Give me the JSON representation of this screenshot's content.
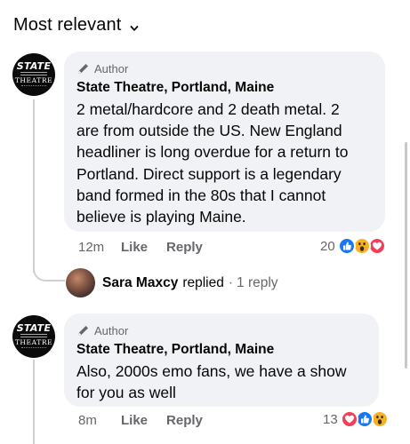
{
  "sort": {
    "label": "Most relevant"
  },
  "comments": [
    {
      "avatar": {
        "top": "STATE",
        "bottom": "THEATRE"
      },
      "badge": "Author",
      "name": "State Theatre, Portland, Maine",
      "lines": [
        "2 metal/hardcore and 2 death metal. 2",
        "are from outside the US. New England",
        "headliner is long overdue for a return to",
        "Portland. Direct support is a legendary",
        "band formed in the 80s that I cannot",
        "believe is playing Maine."
      ],
      "time": "12m",
      "like": "Like",
      "reply": "Reply",
      "reaction_count": "20",
      "reaction_icons": [
        "like-icon",
        "wow-icon",
        "love-icon"
      ]
    },
    {
      "avatar": {
        "top": "STATE",
        "bottom": "THEATRE"
      },
      "badge": "Author",
      "name": "State Theatre, Portland, Maine",
      "lines": [
        "Also, 2000s emo fans, we have a show",
        "for you as well"
      ],
      "time": "8m",
      "like": "Like",
      "reply": "Reply",
      "reaction_count": "13",
      "reaction_icons": [
        "love-icon",
        "like-icon",
        "wow-icon"
      ]
    }
  ],
  "replied": {
    "name": "Sara Maxcy",
    "verb": "replied",
    "dot": "·",
    "count": "1 reply"
  },
  "colors": {
    "bubble": "#f0f2f5",
    "secondary_text": "#65676b",
    "like_blue": "#1877f2",
    "love_red": "#f33e58",
    "wow_yellow": "#f7b125"
  }
}
